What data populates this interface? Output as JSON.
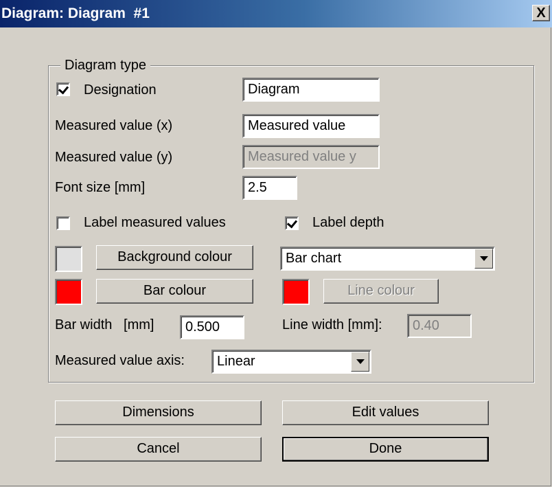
{
  "window": {
    "title": "Diagram: Diagram  #1",
    "close_glyph": "X"
  },
  "group": {
    "title": "Diagram type"
  },
  "designation": {
    "label": "Designation",
    "checked": true,
    "value": "Diagram"
  },
  "measured_x": {
    "label": "Measured value (x)",
    "value": "Measured value"
  },
  "measured_y": {
    "label": "Measured value (y)",
    "value": "Measured value y",
    "enabled": false
  },
  "font_size": {
    "label": "Font size [mm]",
    "value": "2.5"
  },
  "label_measured": {
    "label": "Label measured values",
    "checked": false
  },
  "label_depth": {
    "label": "Label depth",
    "checked": true
  },
  "background": {
    "button_label": "Background colour",
    "swatch_color": "#e0e0e0"
  },
  "chart_type": {
    "selected": "Bar chart"
  },
  "bar_colour": {
    "button_label": "Bar colour",
    "swatch_color": "#ff0000"
  },
  "line_colour": {
    "button_label": "Line colour",
    "swatch_color": "#ff0000",
    "enabled": false
  },
  "bar_width": {
    "label": "Bar width   [mm]",
    "value": "0.500"
  },
  "line_width": {
    "label": "Line width [mm]:",
    "value": "0.40",
    "enabled": false
  },
  "axis": {
    "label": "Measured value axis:",
    "selected": "Linear"
  },
  "buttons": {
    "dimensions": "Dimensions",
    "edit_values": "Edit values",
    "cancel": "Cancel",
    "done": "Done"
  }
}
